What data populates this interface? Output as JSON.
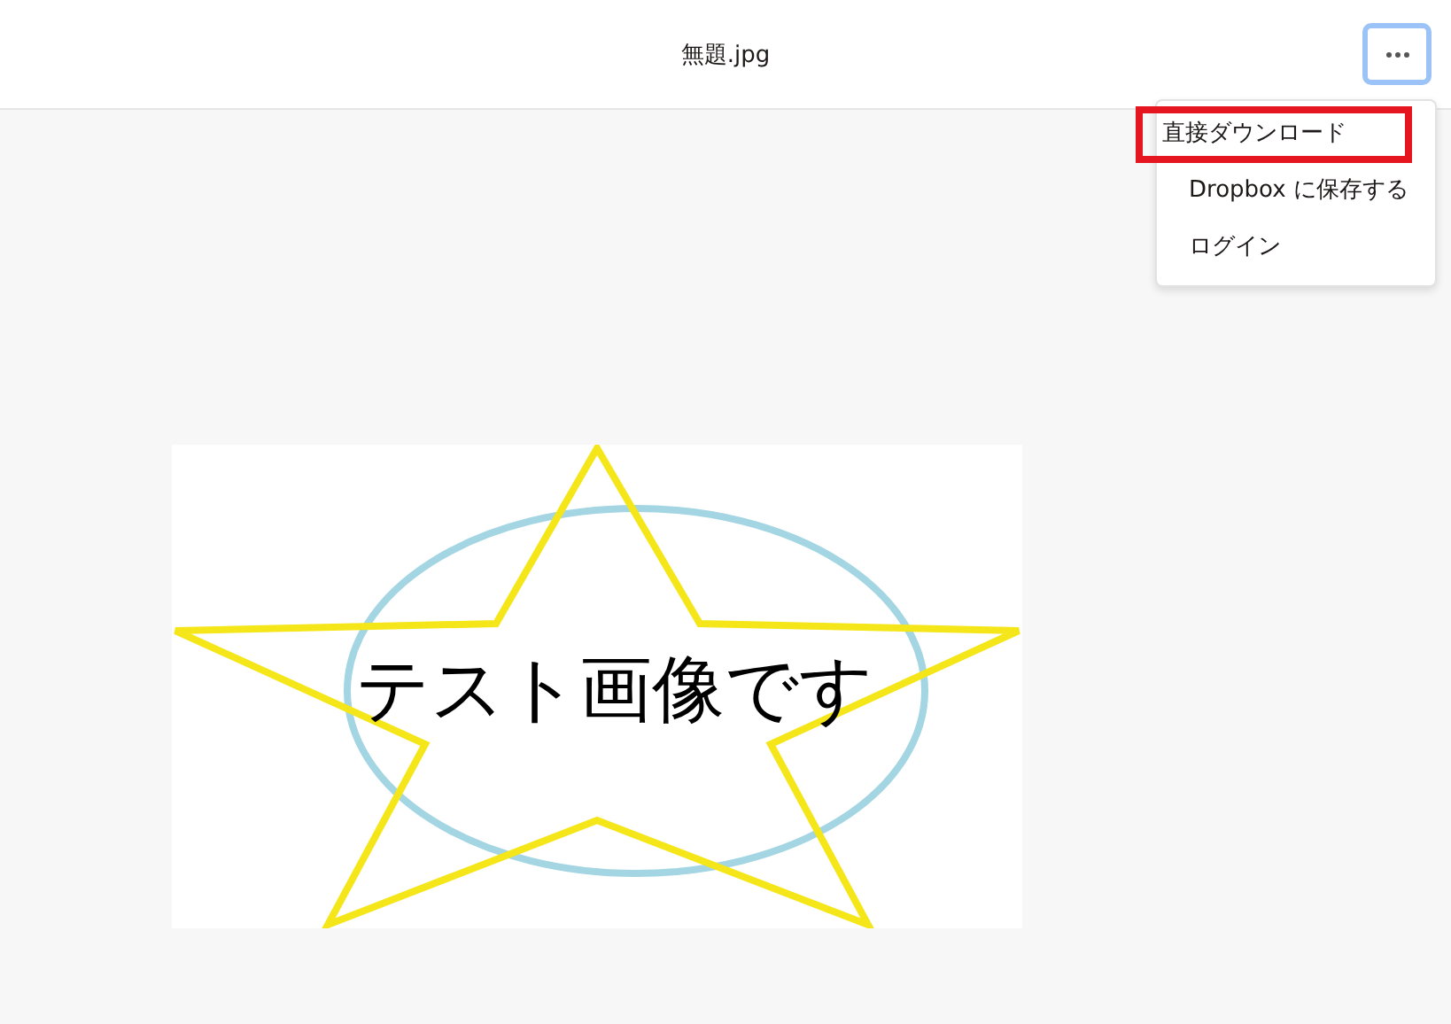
{
  "header": {
    "file_name": "無題.jpg",
    "more_button": {
      "focused": true
    }
  },
  "menu": {
    "items": [
      {
        "label": "直接ダウンロード",
        "highlighted": true
      },
      {
        "label": "Dropbox に保存する",
        "highlighted": false
      },
      {
        "label": "ログイン",
        "highlighted": false
      }
    ]
  },
  "preview": {
    "image_text": "テスト画像です"
  }
}
